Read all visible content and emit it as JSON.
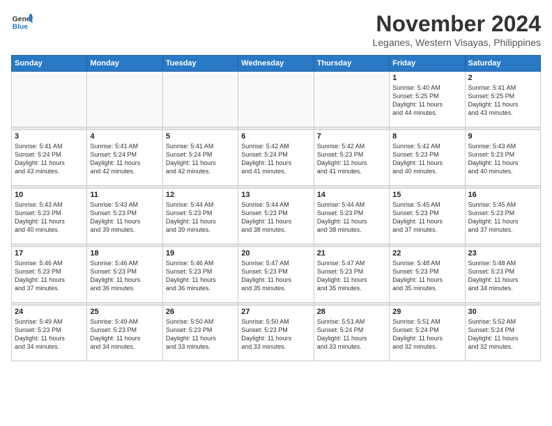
{
  "logo": {
    "line1": "General",
    "line2": "Blue"
  },
  "title": "November 2024",
  "subtitle": "Leganes, Western Visayas, Philippines",
  "weekdays": [
    "Sunday",
    "Monday",
    "Tuesday",
    "Wednesday",
    "Thursday",
    "Friday",
    "Saturday"
  ],
  "weeks": [
    [
      {
        "day": "",
        "info": ""
      },
      {
        "day": "",
        "info": ""
      },
      {
        "day": "",
        "info": ""
      },
      {
        "day": "",
        "info": ""
      },
      {
        "day": "",
        "info": ""
      },
      {
        "day": "1",
        "info": "Sunrise: 5:40 AM\nSunset: 5:25 PM\nDaylight: 11 hours\nand 44 minutes."
      },
      {
        "day": "2",
        "info": "Sunrise: 5:41 AM\nSunset: 5:25 PM\nDaylight: 11 hours\nand 43 minutes."
      }
    ],
    [
      {
        "day": "3",
        "info": "Sunrise: 5:41 AM\nSunset: 5:24 PM\nDaylight: 11 hours\nand 43 minutes."
      },
      {
        "day": "4",
        "info": "Sunrise: 5:41 AM\nSunset: 5:24 PM\nDaylight: 11 hours\nand 42 minutes."
      },
      {
        "day": "5",
        "info": "Sunrise: 5:41 AM\nSunset: 5:24 PM\nDaylight: 11 hours\nand 42 minutes."
      },
      {
        "day": "6",
        "info": "Sunrise: 5:42 AM\nSunset: 5:24 PM\nDaylight: 11 hours\nand 41 minutes."
      },
      {
        "day": "7",
        "info": "Sunrise: 5:42 AM\nSunset: 5:23 PM\nDaylight: 11 hours\nand 41 minutes."
      },
      {
        "day": "8",
        "info": "Sunrise: 5:42 AM\nSunset: 5:23 PM\nDaylight: 11 hours\nand 40 minutes."
      },
      {
        "day": "9",
        "info": "Sunrise: 5:43 AM\nSunset: 5:23 PM\nDaylight: 11 hours\nand 40 minutes."
      }
    ],
    [
      {
        "day": "10",
        "info": "Sunrise: 5:43 AM\nSunset: 5:23 PM\nDaylight: 11 hours\nand 40 minutes."
      },
      {
        "day": "11",
        "info": "Sunrise: 5:43 AM\nSunset: 5:23 PM\nDaylight: 11 hours\nand 39 minutes."
      },
      {
        "day": "12",
        "info": "Sunrise: 5:44 AM\nSunset: 5:23 PM\nDaylight: 11 hours\nand 39 minutes."
      },
      {
        "day": "13",
        "info": "Sunrise: 5:44 AM\nSunset: 5:23 PM\nDaylight: 11 hours\nand 38 minutes."
      },
      {
        "day": "14",
        "info": "Sunrise: 5:44 AM\nSunset: 5:23 PM\nDaylight: 11 hours\nand 38 minutes."
      },
      {
        "day": "15",
        "info": "Sunrise: 5:45 AM\nSunset: 5:23 PM\nDaylight: 11 hours\nand 37 minutes."
      },
      {
        "day": "16",
        "info": "Sunrise: 5:45 AM\nSunset: 5:23 PM\nDaylight: 11 hours\nand 37 minutes."
      }
    ],
    [
      {
        "day": "17",
        "info": "Sunrise: 5:46 AM\nSunset: 5:23 PM\nDaylight: 11 hours\nand 37 minutes."
      },
      {
        "day": "18",
        "info": "Sunrise: 5:46 AM\nSunset: 5:23 PM\nDaylight: 11 hours\nand 36 minutes."
      },
      {
        "day": "19",
        "info": "Sunrise: 5:46 AM\nSunset: 5:23 PM\nDaylight: 11 hours\nand 36 minutes."
      },
      {
        "day": "20",
        "info": "Sunrise: 5:47 AM\nSunset: 5:23 PM\nDaylight: 11 hours\nand 35 minutes."
      },
      {
        "day": "21",
        "info": "Sunrise: 5:47 AM\nSunset: 5:23 PM\nDaylight: 11 hours\nand 35 minutes."
      },
      {
        "day": "22",
        "info": "Sunrise: 5:48 AM\nSunset: 5:23 PM\nDaylight: 11 hours\nand 35 minutes."
      },
      {
        "day": "23",
        "info": "Sunrise: 5:48 AM\nSunset: 5:23 PM\nDaylight: 11 hours\nand 34 minutes."
      }
    ],
    [
      {
        "day": "24",
        "info": "Sunrise: 5:49 AM\nSunset: 5:23 PM\nDaylight: 11 hours\nand 34 minutes."
      },
      {
        "day": "25",
        "info": "Sunrise: 5:49 AM\nSunset: 5:23 PM\nDaylight: 11 hours\nand 34 minutes."
      },
      {
        "day": "26",
        "info": "Sunrise: 5:50 AM\nSunset: 5:23 PM\nDaylight: 11 hours\nand 33 minutes."
      },
      {
        "day": "27",
        "info": "Sunrise: 5:50 AM\nSunset: 5:23 PM\nDaylight: 11 hours\nand 33 minutes."
      },
      {
        "day": "28",
        "info": "Sunrise: 5:51 AM\nSunset: 5:24 PM\nDaylight: 11 hours\nand 33 minutes."
      },
      {
        "day": "29",
        "info": "Sunrise: 5:51 AM\nSunset: 5:24 PM\nDaylight: 11 hours\nand 32 minutes."
      },
      {
        "day": "30",
        "info": "Sunrise: 5:52 AM\nSunset: 5:24 PM\nDaylight: 11 hours\nand 32 minutes."
      }
    ]
  ]
}
